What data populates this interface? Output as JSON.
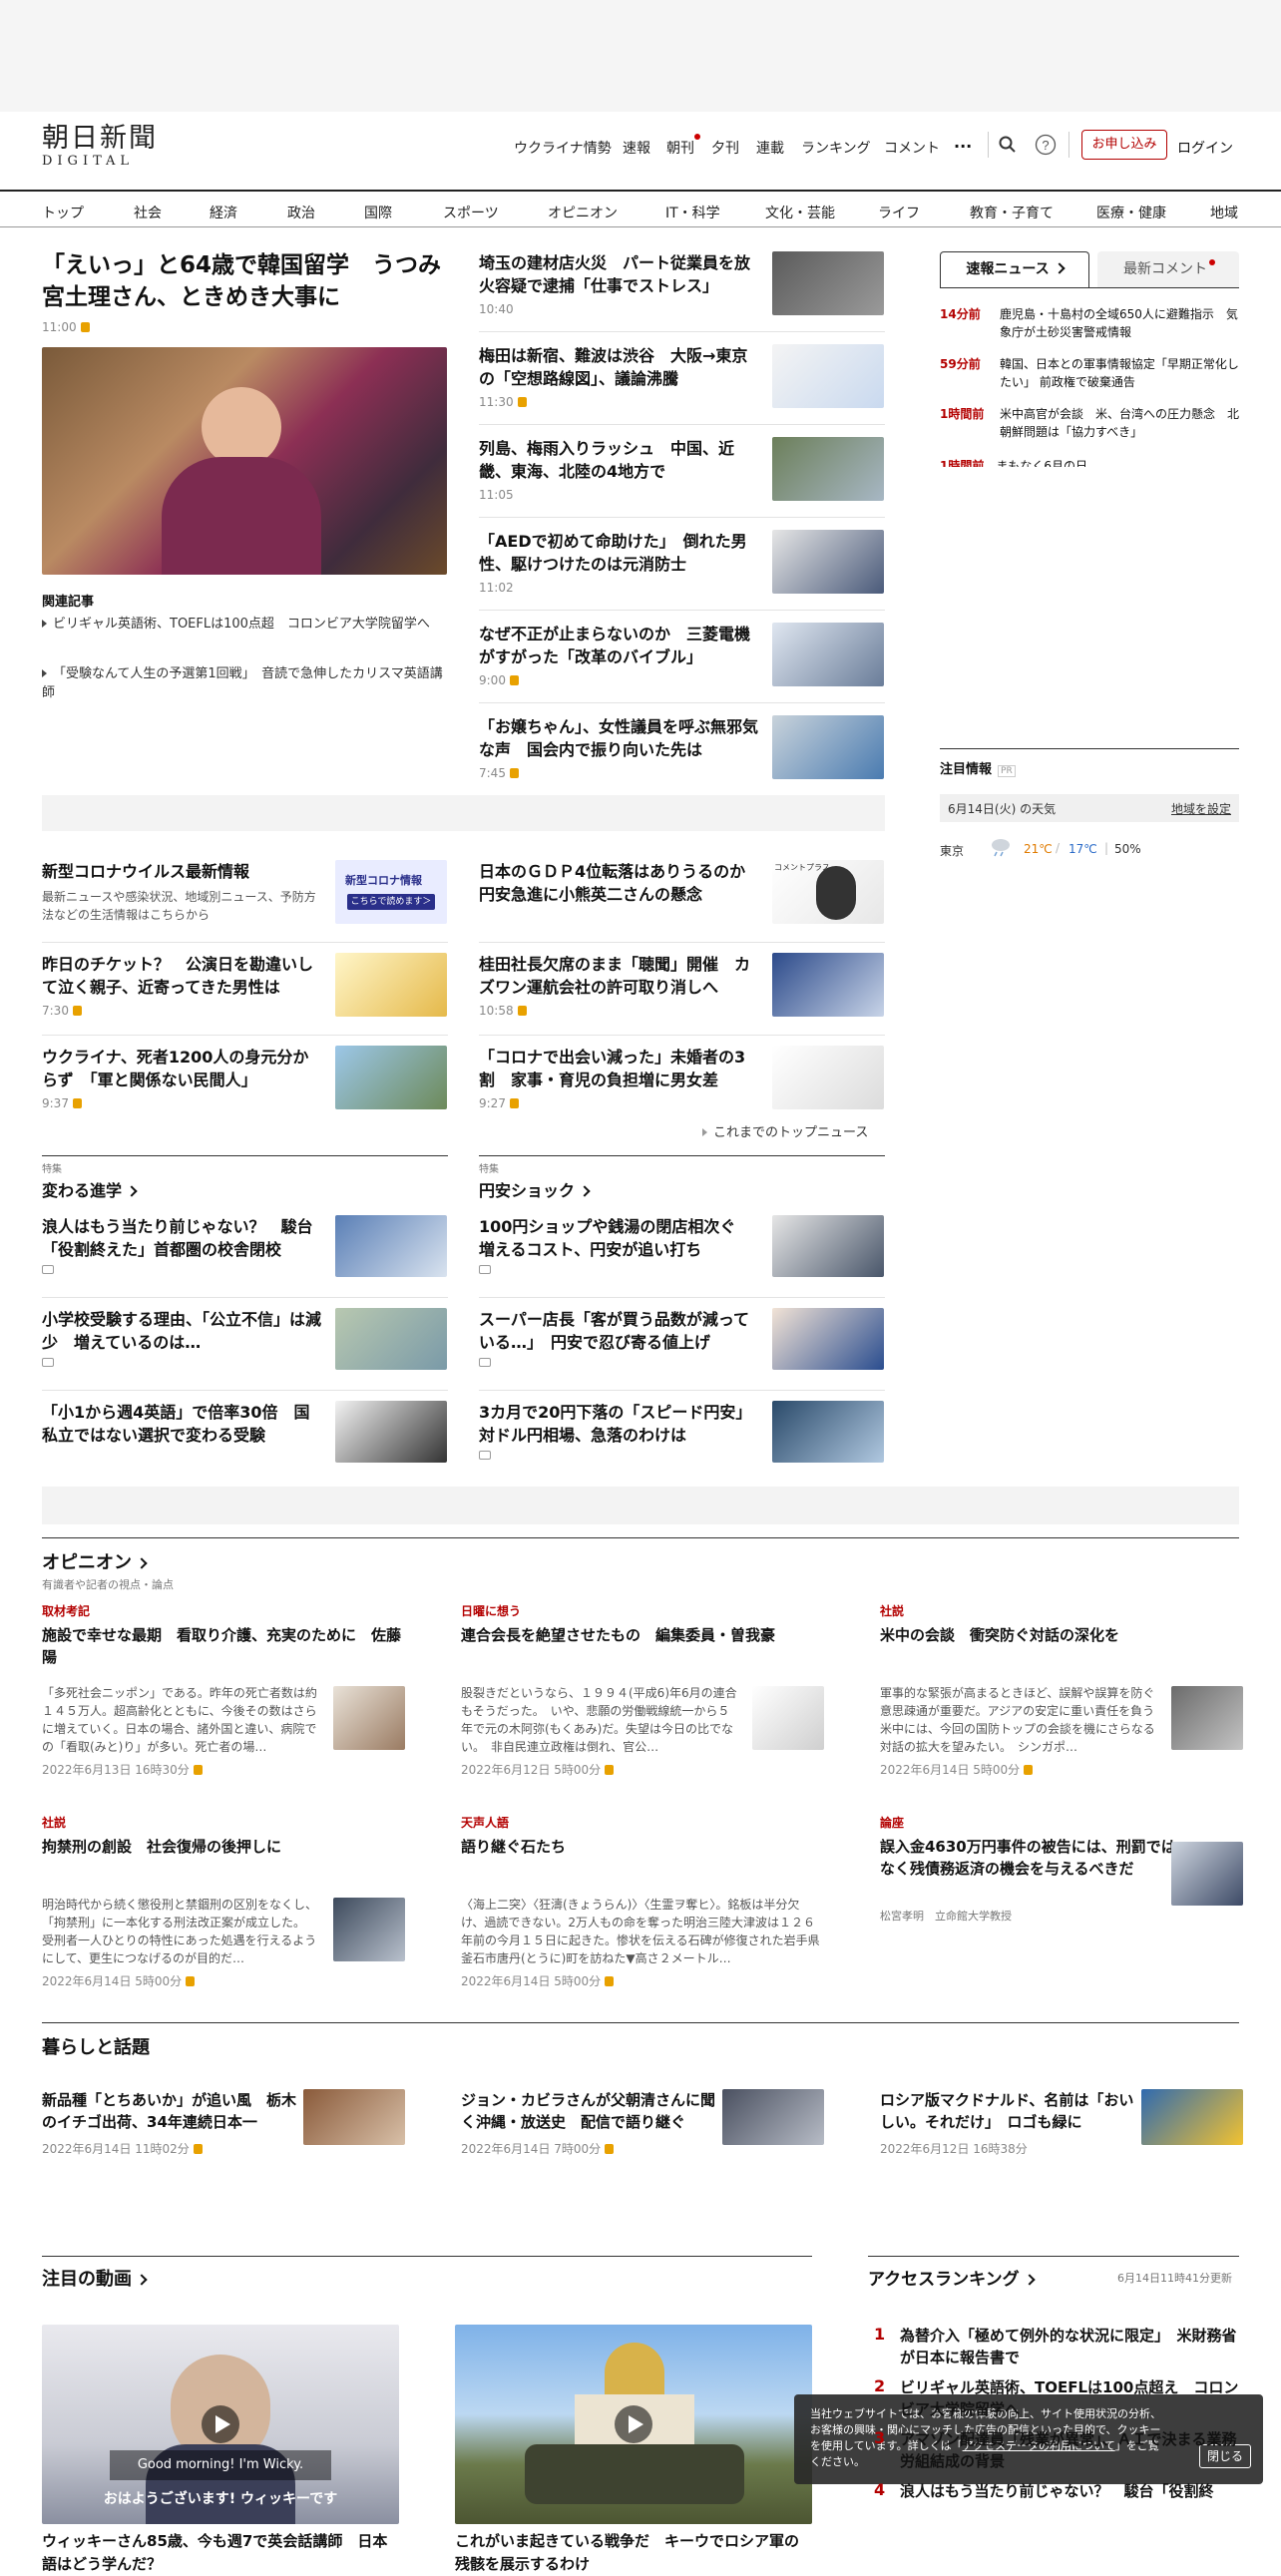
{
  "header": {
    "logo_main": "朝日新聞",
    "logo_sub": "DIGITAL",
    "nav": [
      "ウクライナ情勢",
      "速報",
      "朝刊",
      "夕刊",
      "連載",
      "ランキング",
      "コメント"
    ],
    "subscribe": "お申し込み",
    "login": "ログイン"
  },
  "global_nav": [
    "トップ",
    "社会",
    "経済",
    "政治",
    "国際",
    "スポーツ",
    "オピニオン",
    "IT・科学",
    "文化・芸能",
    "ライフ",
    "教育・子育て",
    "医療・健康",
    "地域"
  ],
  "hero": {
    "title": "「えいっ」と64歳で韓国留学　うつみ宮土理さん、ときめき大事に",
    "time": "11:00",
    "related_label": "関連記事",
    "related": [
      "ビリギャル英語術、TOEFLは100点超　コロンビア大学院留学へ",
      "「受験なんて人生の予選第1回戦」　音読で急伸したカリスマ英語講師"
    ]
  },
  "top_list": [
    {
      "title": "埼玉の建材店火災　パート従業員を放火容疑で逮捕「仕事でストレス」",
      "time": "10:40",
      "lock": false
    },
    {
      "title": "梅田は新宿、難波は渋谷　大阪→東京の「空想路線図」、議論沸騰",
      "time": "11:30",
      "lock": true
    },
    {
      "title": "列島、梅雨入りラッシュ　中国、近畿、東海、北陸の4地方で",
      "time": "11:05",
      "lock": false
    },
    {
      "title": "「AEDで初めて命助けた」　倒れた男性、駆けつけたのは元消防士",
      "time": "11:02",
      "lock": false
    },
    {
      "title": "なぜ不正が止まらないのか　三菱電機がすがった「改革のバイブル」",
      "time": "9:00",
      "lock": true
    },
    {
      "title": "「お嬢ちゃん」、女性議員を呼ぶ無邪気な声　国会内で振り向いた先は",
      "time": "7:45",
      "lock": true
    }
  ],
  "grid_left": [
    {
      "title": "新型コロナウイルス最新情報",
      "desc": "最新ニュースや感染状況、地域別ニュース、予防方法などの生活情報はこちらから",
      "time": "",
      "thumb_text": "新型コロナ情報\nこちらで読めます＞"
    },
    {
      "title": "昨日のチケット？　公演日を勘違いして泣く親子、近寄ってきた男性は",
      "time": "7:30"
    },
    {
      "title": "ウクライナ、死者1200人の身元分からず　「軍と関係ない民間人」",
      "time": "9:37"
    }
  ],
  "grid_right": [
    {
      "title": "日本のＧＤＰ4位転落はありうるのか　円安急進に小熊英二さんの懸念",
      "time": "",
      "badge": "コメントプラス"
    },
    {
      "title": "桂田社長欠席のまま「聴聞」開催　カズワン運航会社の許可取り消しへ",
      "time": "10:58"
    },
    {
      "title": "「コロナで出会い減った」未婚者の3割　家事・育児の負担増に男女差",
      "time": "9:27"
    }
  ],
  "more_top": "これまでのトップニュース",
  "tokushu": [
    {
      "label": "特集",
      "title": "変わる進学",
      "items": [
        "浪人はもう当たり前じゃない？　駿台「役割終えた」首都圏の校舎閉校",
        "小学校受験する理由、「公立不信」は減少　増えているのは…",
        "「小1から週4英語」で倍率30倍　国私立ではない選択で変わる受験"
      ]
    },
    {
      "label": "特集",
      "title": "円安ショック",
      "items": [
        "100円ショップや銭湯の閉店相次ぐ　増えるコスト、円安が追い打ち",
        "スーパー店長「客が買う品数が減っている…」　円安で忍び寄る値上げ",
        "3カ月で20円下落の「スピード円安」　対ドル円相場、急落のわけは"
      ]
    }
  ],
  "sidebar": {
    "tab_breaking": "速報ニュース",
    "tab_comment": "最新コメント",
    "breaking": [
      {
        "ago": "14分前",
        "title": "鹿児島・十島村の全域650人に避難指示　気象庁が土砂災害警戒情報"
      },
      {
        "ago": "59分前",
        "title": "韓国、日本との軍事情報協定「早期正常化したい」 前政権で破棄通告"
      },
      {
        "ago": "1時間前",
        "title": "米中高官が会談　米、台湾への圧力懸念　北朝鮮問題は「協力すべき」"
      },
      {
        "ago": "1時間前",
        "title": "まもなく6月の日…"
      }
    ],
    "notice_title": "注目情報",
    "pr": "PR",
    "weather_date": "6月14日(火) の天気",
    "weather_set": "地域を設定",
    "city": "東京",
    "high": "21℃",
    "low": "17℃",
    "rain": "50%"
  },
  "opinion": {
    "title": "オピニオン",
    "subtitle": "有識者や記者の視点・論点",
    "items": [
      {
        "cat": "取材考記",
        "title": "施設で幸せな最期　看取り介護、充実のために　佐藤陽",
        "desc": "「多死社会ニッポン」である。昨年の死亡者数は約１４５万人。超高齢化とともに、今後その数はさらに増えていく。日本の場合、諸外国と違い、病院での「看取(みと)り」が多い。死亡者の場…",
        "date": "2022年6月13日 16時30分"
      },
      {
        "cat": "日曜に想う",
        "title": "連合会長を絶望させたもの　編集委員・曽我豪",
        "desc": "股裂きだというなら、１９９４(平成6)年6月の連合もそうだった。　いや、悲願の労働戦線統一から５年で元の木阿弥(もくあみ)だ。失望は今日の比でない。　非自民連立政権は倒れ、官公…",
        "date": "2022年6月12日 5時00分"
      },
      {
        "cat": "社説",
        "title": "米中の会談　衝突防ぐ対話の深化を",
        "desc": "軍事的な緊張が高まるときほど、誤解や誤算を防ぐ意思疎通が重要だ。アジアの安定に重い責任を負う米中には、今回の国防トップの会談を機にさらなる対話の拡大を望みたい。　シンガポ…",
        "date": "2022年6月14日 5時00分"
      },
      {
        "cat": "社説",
        "title": "拘禁刑の創設　社会復帰の後押しに",
        "desc": "明治時代から続く懲役刑と禁錮刑の区別をなくし、「拘禁刑」に一本化する刑法改正案が成立した。　受刑者一人ひとりの特性にあった処遇を行えるようにして、更生につなげるのが目的だ…",
        "date": "2022年6月14日 5時00分"
      },
      {
        "cat": "天声人語",
        "title": "語り継ぐ石たち",
        "desc": "〈海上二突〉〈狂濤(きょうらん)〉〈生霊ヲ奪ヒ〉。銘板は半分欠け、過読できない。2万人もの命を奪った明治三陸大津波は１２６年前の今月１５日に起きた。惨状を伝える石碑が修復された岩手県釜石市唐丹(とうに)町を訪ねた▼高さ２メートル…",
        "date": "2022年6月14日 5時00分"
      },
      {
        "cat": "論座",
        "title": "誤入金4630万円事件の被告には、刑罰ではなく残債務返済の機会を与えるべきだ",
        "desc": "松宮孝明　立命館大学教授",
        "date": ""
      }
    ]
  },
  "kurashi": {
    "title": "暮らしと話題",
    "items": [
      {
        "title": "新品種「とちあいか」が追い風　栃木のイチゴ出荷、34年連続日本一",
        "date": "2022年6月14日 11時02分"
      },
      {
        "title": "ジョン・カビラさんが父朝清さんに聞く沖縄・放送史　配信で語り継ぐ",
        "date": "2022年6月14日 7時00分"
      },
      {
        "title": "ロシア版マクドナルド、名前は「おいしい。それだけ」　ロゴも緑に",
        "date": "2022年6月12日 16時38分"
      }
    ]
  },
  "videos": {
    "title": "注目の動画",
    "items": [
      {
        "title": "ウィッキーさん85歳、今も週7で英会話講師　日本語はどう学んだ？",
        "caption": "Good morning! I'm Wicky.",
        "caption2": "おはようございます! ウィッキーです"
      },
      {
        "title": "これがいま起きている戦争だ　キーウでロシア軍の残骸を展示するわけ"
      }
    ]
  },
  "ranking": {
    "title": "アクセスランキング",
    "updated": "6月14日11時41分更新",
    "items": [
      {
        "rank": "1",
        "title": "為替介入「極めて例外的な状況に限定」　米財務省が日本に報告書で"
      },
      {
        "rank": "2",
        "title": "ビリギャル英語術、TOEFLは100点超え　コロンビア大学院留学へ"
      },
      {
        "rank": "3",
        "title": "アマゾン配達員「残業が異常」、ＡＩで決まる業務　労組結成の背景"
      },
      {
        "rank": "4",
        "title": "浪人はもう当たり前じゃない？　駿台「役割終"
      }
    ]
  },
  "cookie": {
    "text": "当社ウェブサイトでは、お客様の体験の向上、サイト使用状況の分析、お客様の興味・関心にマッチした広告の配信といった目的で、クッキーを使用しています。詳しくは「",
    "link": "アクセスデータの利用について",
    "text2": "」をご覧ください。",
    "close": "閉じる"
  }
}
